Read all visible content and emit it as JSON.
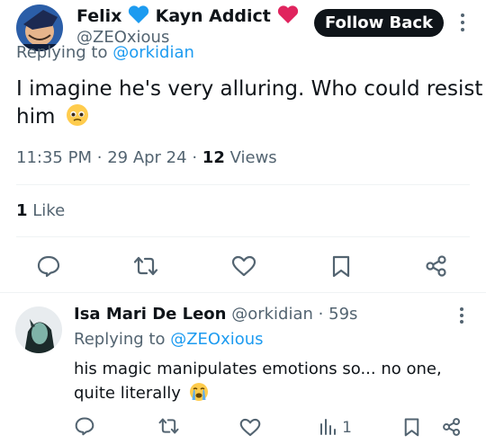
{
  "main_tweet": {
    "author_name": "Felix",
    "author_name_2": "Kayn Addict",
    "author_handle": "@ZEOxious",
    "follow_button": "Follow Back",
    "replying_prefix": "Replying to",
    "replying_to": "@orkidian",
    "text_line1": "I imagine he's very alluring. Who could resist",
    "text_line2": "him",
    "time": "11:35 PM",
    "dot": "·",
    "date": "29 Apr 24",
    "views_count": "12",
    "views_label": "Views",
    "likes_count": "1",
    "likes_label": "Like"
  },
  "reply_tweet": {
    "author_name": "Isa Mari De Leon",
    "author_handle": "@orkidian",
    "dot": "·",
    "time": "59s",
    "replying_prefix": "Replying to",
    "replying_to": "@ZEOxious",
    "text_line1": "his magic manipulates emotions so... no one,",
    "text_line2": "quite literally",
    "views_count": "1"
  },
  "colors": {
    "heart_red": "#e0245e",
    "heart_blue": "#1d9bf0",
    "link": "#1d9bf0",
    "muted": "#536471"
  }
}
